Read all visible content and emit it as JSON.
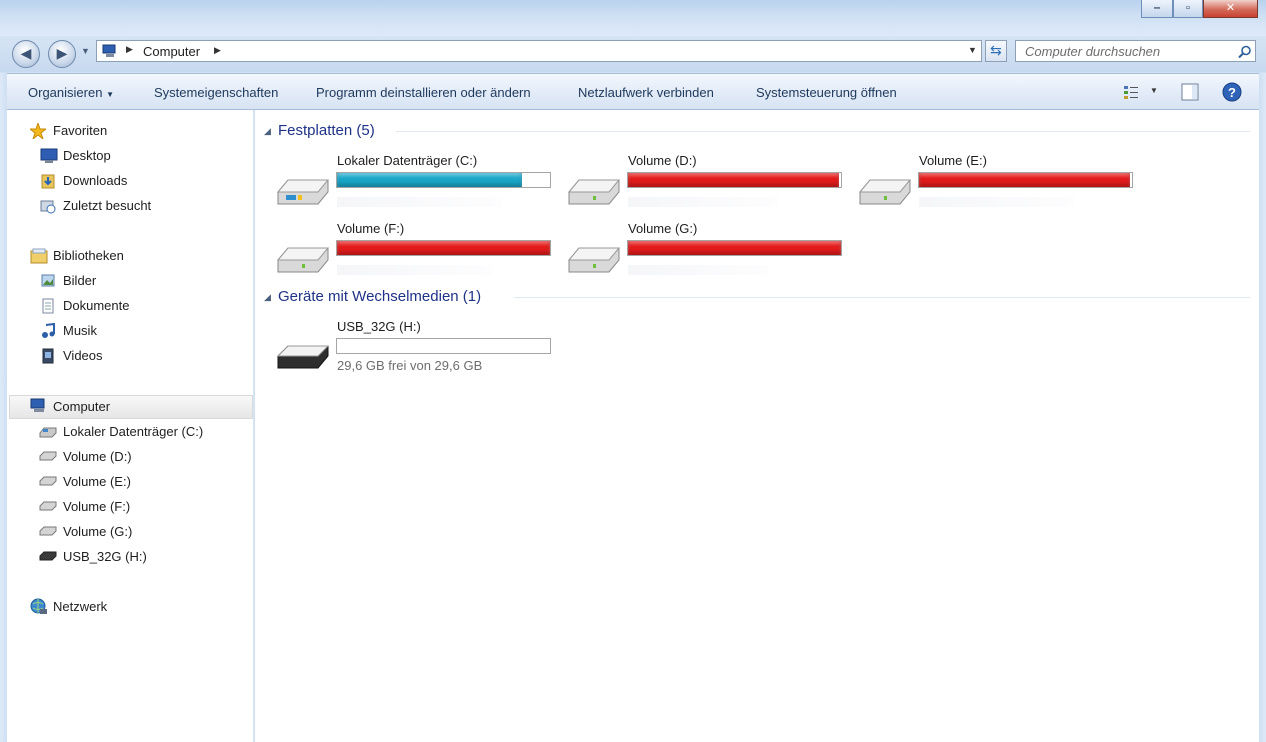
{
  "address": {
    "path": [
      "Computer"
    ],
    "search_placeholder": "Computer durchsuchen"
  },
  "commands": {
    "organize": "Organisieren",
    "system_properties": "Systemeigenschaften",
    "uninstall": "Programm deinstallieren oder ändern",
    "map_drive": "Netzlaufwerk verbinden",
    "control_panel": "Systemsteuerung öffnen"
  },
  "nav": {
    "favorites": "Favoriten",
    "desktop": "Desktop",
    "downloads": "Downloads",
    "recent": "Zuletzt besucht",
    "libraries": "Bibliotheken",
    "pictures": "Bilder",
    "documents": "Dokumente",
    "music": "Musik",
    "videos": "Videos",
    "computer": "Computer",
    "drive_c": "Lokaler Datenträger (C:)",
    "drive_d": "Volume (D:)",
    "drive_e": "Volume (E:)",
    "drive_f": "Volume (F:)",
    "drive_g": "Volume (G:)",
    "drive_h": "USB_32G (H:)",
    "network": "Netzwerk"
  },
  "groups": {
    "hard_disks": "Festplatten (5)",
    "removable": "Geräte mit Wechselmedien (1)"
  },
  "drives": {
    "c": {
      "name": "Lokaler Datenträger (C:)",
      "used_fraction": 0.87,
      "color": "#1aa7c9"
    },
    "d": {
      "name": "Volume (D:)",
      "used_fraction": 0.99,
      "color": "#e41b1b"
    },
    "e": {
      "name": "Volume (E:)",
      "used_fraction": 0.99,
      "color": "#e41b1b"
    },
    "f": {
      "name": "Volume (F:)",
      "used_fraction": 1.0,
      "color": "#e41b1b"
    },
    "g": {
      "name": "Volume (G:)",
      "used_fraction": 1.0,
      "color": "#e41b1b"
    },
    "h": {
      "name": "USB_32G (H:)",
      "used_fraction": 0.0,
      "color": "#1aa7c9",
      "free_text": "29,6 GB frei von 29,6 GB"
    }
  },
  "icons": [
    "back-icon",
    "forward-icon",
    "computer-icon",
    "refresh-icon",
    "search-icon",
    "view-icon",
    "preview-pane-icon",
    "help-icon",
    "star-icon",
    "desktop-icon",
    "downloads-icon",
    "recent-icon",
    "library-icon",
    "pictures-icon",
    "documents-icon",
    "music-icon",
    "videos-icon",
    "drive-icon",
    "usb-drive-icon",
    "network-icon"
  ]
}
